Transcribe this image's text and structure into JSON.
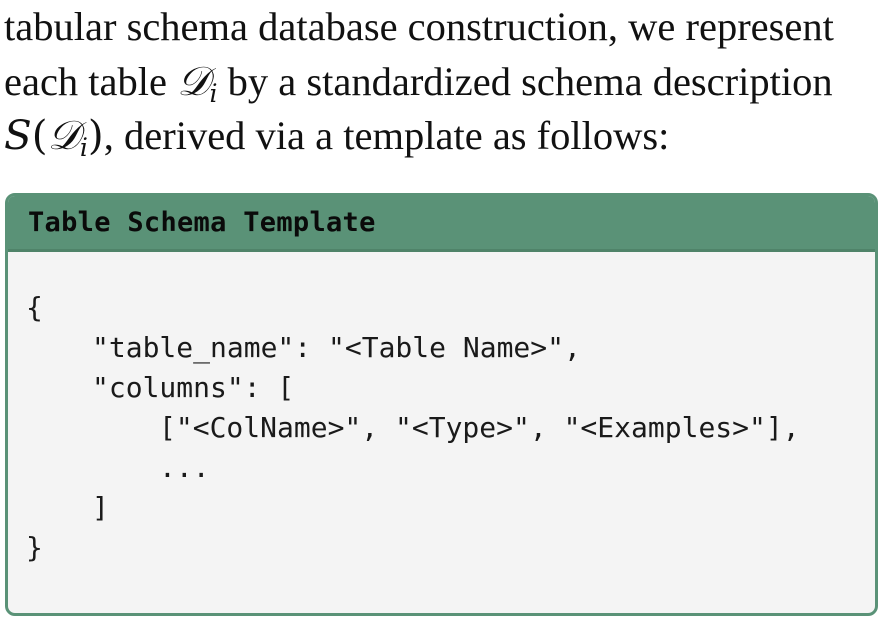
{
  "paragraph": {
    "line1": "tabular schema database construction, we represent",
    "line2_before": "each table ",
    "line2_after": " by a standardized schema description",
    "line3_after": ", derived via a template as follows:",
    "math_table_symbol": "𝒟",
    "math_subscript": "i",
    "math_function": "S",
    "math_open_paren": "(",
    "math_close_paren": ")"
  },
  "template_box": {
    "title": "Table Schema Template",
    "code_lines": [
      "{",
      "\"table_name\": \"<Table Name>\",",
      "\"columns\": [",
      "[\"<ColName>\", \"<Type>\", \"<Examples>\"],",
      "...",
      "]",
      "}"
    ]
  },
  "colors": {
    "box_accent": "#5a9277",
    "box_body_background": "#f4f4f4",
    "text": "#111111"
  }
}
